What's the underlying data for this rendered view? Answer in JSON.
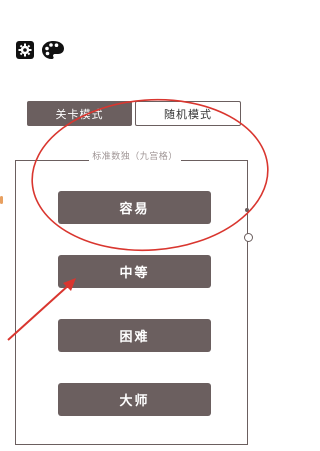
{
  "toolbar": {
    "settings_icon": "gear-icon",
    "theme_icon": "palette-icon"
  },
  "tabs": [
    {
      "label": "关卡模式",
      "active": true
    },
    {
      "label": "随机模式",
      "active": false
    }
  ],
  "panel": {
    "title": "标准数独（九宫格）"
  },
  "levels": [
    {
      "label": "容易"
    },
    {
      "label": "中等"
    },
    {
      "label": "困难"
    },
    {
      "label": "大师"
    }
  ],
  "colors": {
    "primary": "#6b5f5f",
    "annotation": "#d9362f"
  }
}
